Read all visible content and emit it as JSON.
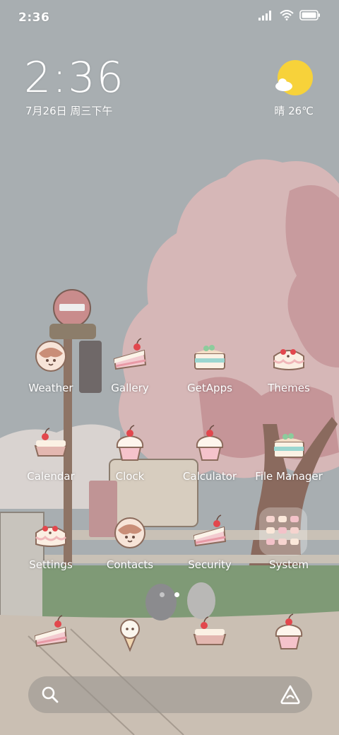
{
  "status_bar": {
    "time": "2:36"
  },
  "clock_widget": {
    "time": "2:36",
    "date": "7月26日 周三下午"
  },
  "weather_widget": {
    "text": "晴 26℃",
    "icon": "sun-cloud-icon"
  },
  "apps": [
    {
      "label": "Weather",
      "icon": "cake-donut-icon"
    },
    {
      "label": "Gallery",
      "icon": "cake-slice-icon"
    },
    {
      "label": "GetApps",
      "icon": "cake-layer-icon"
    },
    {
      "label": "Themes",
      "icon": "cake-cherries-icon"
    },
    {
      "label": "Calendar",
      "icon": "cake-tart-icon"
    },
    {
      "label": "Clock",
      "icon": "cupcake-icon"
    },
    {
      "label": "Calculator",
      "icon": "cupcake-icon"
    },
    {
      "label": "File Manager",
      "icon": "cake-layer-icon"
    },
    {
      "label": "Settings",
      "icon": "cake-cherries-icon"
    },
    {
      "label": "Contacts",
      "icon": "cake-donut-icon"
    },
    {
      "label": "Security",
      "icon": "cake-slice-icon"
    },
    {
      "label": "System",
      "icon": "folder-icon"
    }
  ],
  "dock": [
    {
      "icon": "cake-slice-icon"
    },
    {
      "icon": "ice-cream-icon"
    },
    {
      "icon": "cake-tart-icon"
    },
    {
      "icon": "cupcake-icon"
    }
  ],
  "page_indicator": {
    "count": 2,
    "active": 1
  },
  "colors": {
    "sky": "#a7adb1",
    "blossom": "#d9b1b2",
    "grass": "#7f9a76",
    "sun": "#f7d23a"
  }
}
